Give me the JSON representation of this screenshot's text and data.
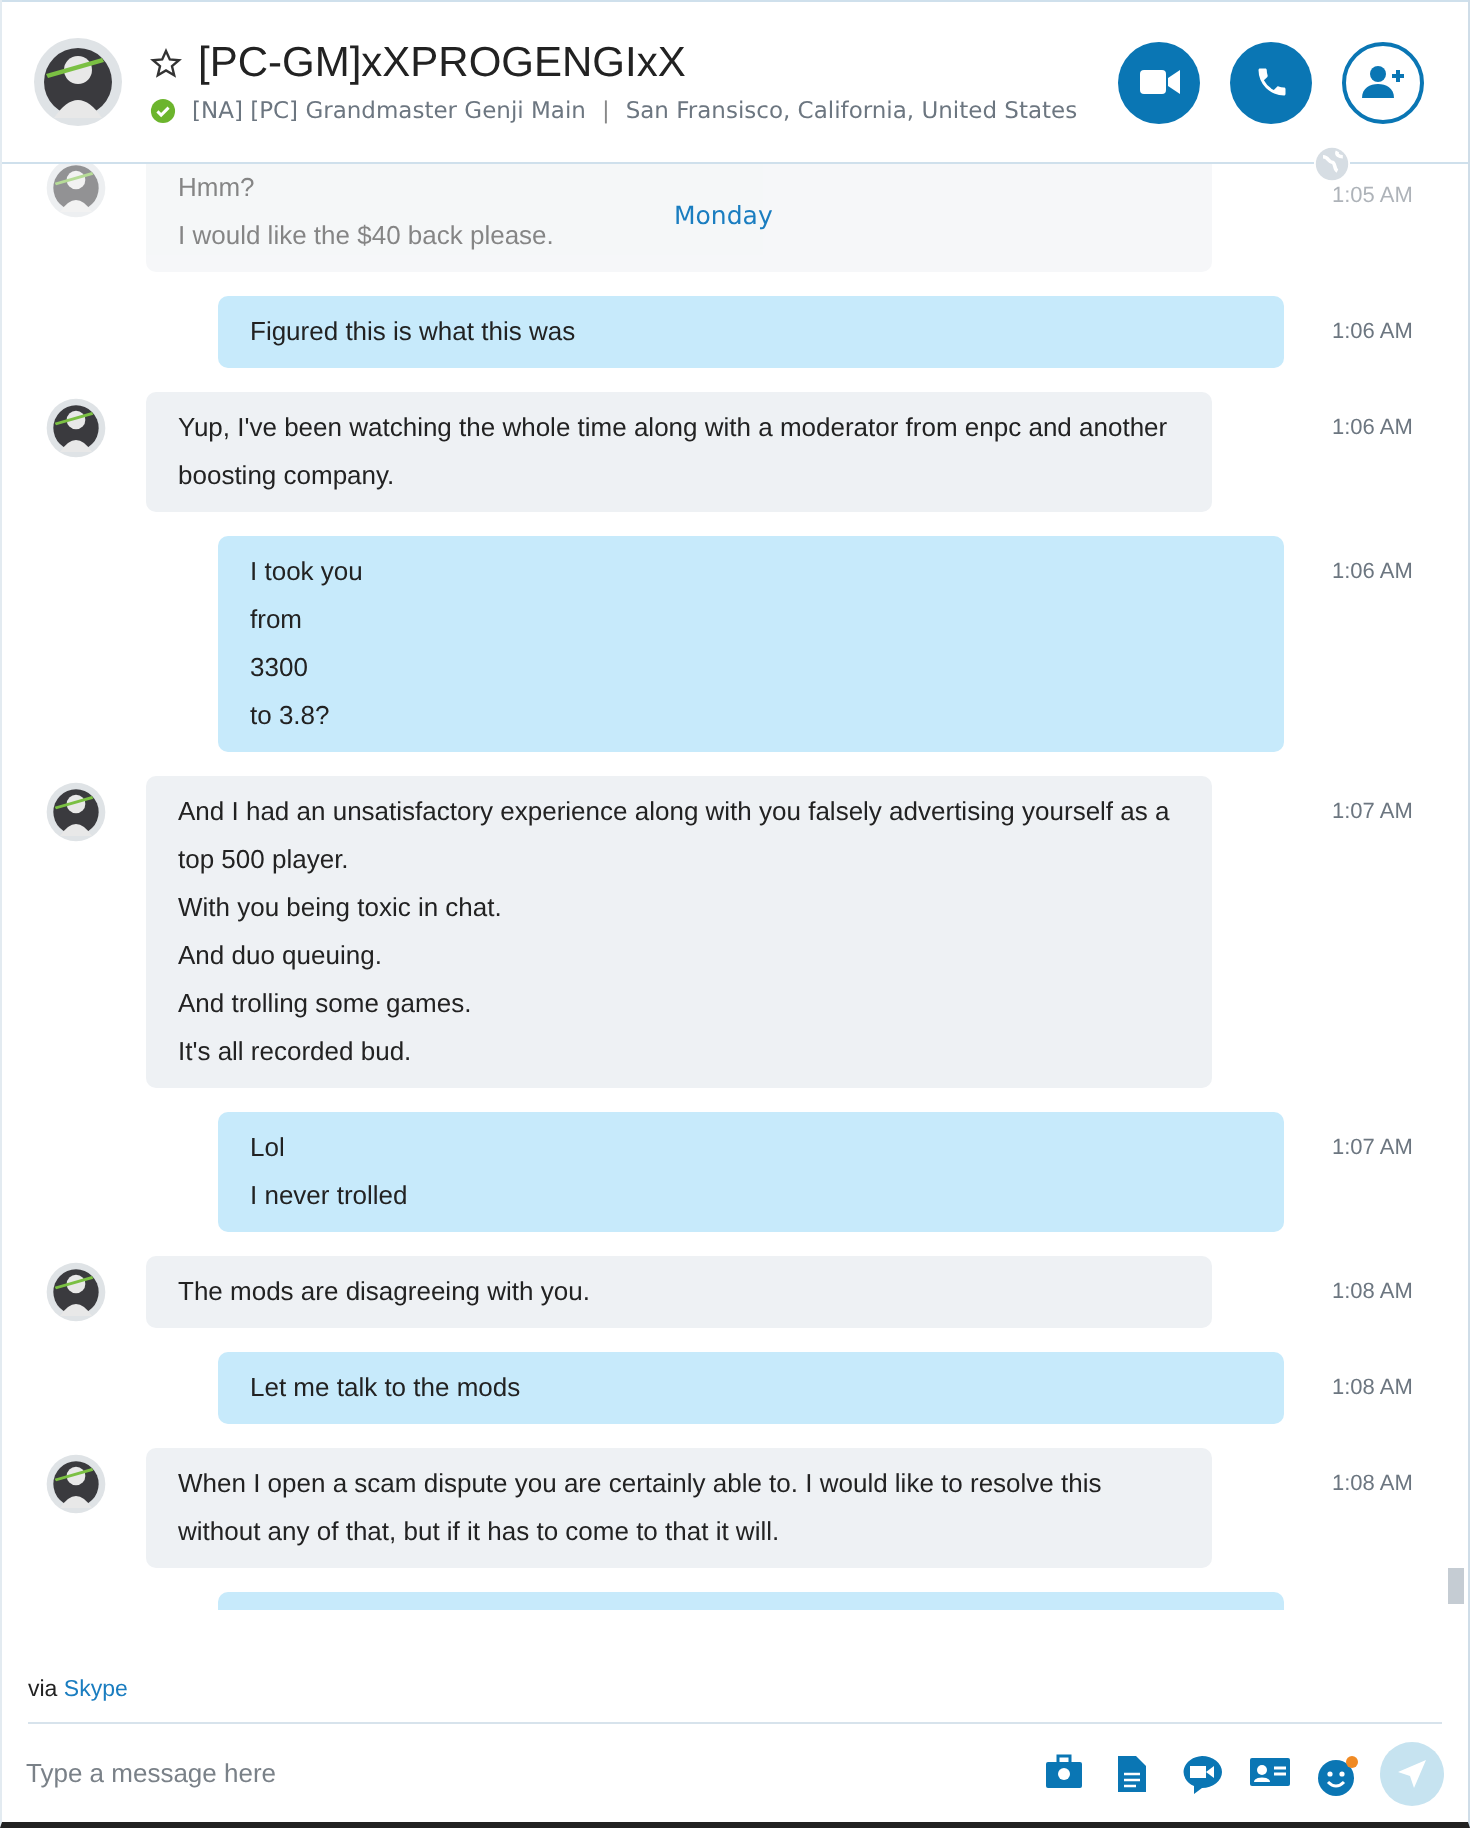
{
  "contact": {
    "name": "[PC-GM]xXPROGENGIxX",
    "favorite": false,
    "online": true,
    "mood": "[NA] [PC] Grandmaster Genji Main",
    "separator": "|",
    "location": "San Fransisco, California, United States"
  },
  "day_label": "Monday",
  "messages": [
    {
      "kind": "incoming",
      "faded": true,
      "lines": [
        "Hmm?",
        "I would like the $40 back please."
      ],
      "time": "1:05 AM"
    },
    {
      "kind": "outgoing",
      "faded": false,
      "lines": [
        "Figured this is what this was"
      ],
      "time": "1:06 AM"
    },
    {
      "kind": "incoming",
      "faded": false,
      "lines": [
        "Yup, I've been watching the whole time along with a moderator from enpc and another boosting company."
      ],
      "time": "1:06 AM"
    },
    {
      "kind": "outgoing",
      "faded": false,
      "lines": [
        "I took you",
        "from",
        "3300",
        "to 3.8?"
      ],
      "time": "1:06 AM"
    },
    {
      "kind": "incoming",
      "faded": false,
      "lines": [
        "And I had an unsatisfactory experience along with you falsely advertising yourself as a top 500 player.",
        "With you being toxic in chat.",
        "And duo queuing.",
        "And trolling some games.",
        "It's all recorded bud."
      ],
      "time": "1:07 AM"
    },
    {
      "kind": "outgoing",
      "faded": false,
      "lines": [
        "Lol",
        "I never trolled"
      ],
      "time": "1:07 AM"
    },
    {
      "kind": "incoming",
      "faded": false,
      "lines": [
        "The mods are disagreeing with you."
      ],
      "time": "1:08 AM"
    },
    {
      "kind": "outgoing",
      "faded": false,
      "lines": [
        "Let me talk to the mods"
      ],
      "time": "1:08 AM"
    },
    {
      "kind": "incoming",
      "faded": false,
      "lines": [
        "When I open a scam dispute you are certainly able to. I would like to resolve this without any of that, but if it has to come to that it will."
      ],
      "time": "1:08 AM"
    },
    {
      "kind": "outgoing",
      "faded": false
    }
  ],
  "via": {
    "prefix": "via",
    "link": "Skype"
  },
  "composer": {
    "placeholder": "Type a message here"
  }
}
